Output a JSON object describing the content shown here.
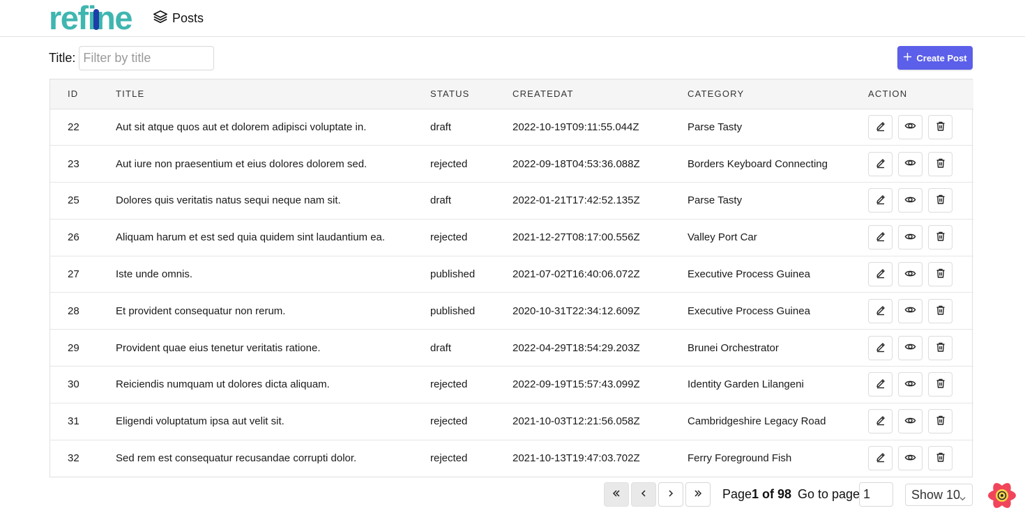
{
  "header": {
    "logo_text": "refine",
    "nav_label": "Posts"
  },
  "filter": {
    "label": "Title:",
    "placeholder": "Filter by title"
  },
  "create_button": {
    "label": "Create Post"
  },
  "table": {
    "columns": [
      "ID",
      "TITLE",
      "STATUS",
      "CREATEDAT",
      "CATEGORY",
      "ACTION"
    ],
    "rows": [
      {
        "id": "22",
        "title": "Aut sit atque quos aut et dolorem adipisci voluptate in.",
        "status": "draft",
        "created": "2022-10-19T09:11:55.044Z",
        "category": "Parse Tasty"
      },
      {
        "id": "23",
        "title": "Aut iure non praesentium et eius dolores dolorem sed.",
        "status": "rejected",
        "created": "2022-09-18T04:53:36.088Z",
        "category": "Borders Keyboard Connecting"
      },
      {
        "id": "25",
        "title": "Dolores quis veritatis natus sequi neque nam sit.",
        "status": "draft",
        "created": "2022-01-21T17:42:52.135Z",
        "category": "Parse Tasty"
      },
      {
        "id": "26",
        "title": "Aliquam harum et est sed quia quidem sint laudantium ea.",
        "status": "rejected",
        "created": "2021-12-27T08:17:00.556Z",
        "category": "Valley Port Car"
      },
      {
        "id": "27",
        "title": "Iste unde omnis.",
        "status": "published",
        "created": "2021-07-02T16:40:06.072Z",
        "category": "Executive Process Guinea"
      },
      {
        "id": "28",
        "title": "Et provident consequatur non rerum.",
        "status": "published",
        "created": "2020-10-31T22:34:12.609Z",
        "category": "Executive Process Guinea"
      },
      {
        "id": "29",
        "title": "Provident quae eius tenetur veritatis ratione.",
        "status": "draft",
        "created": "2022-04-29T18:54:29.203Z",
        "category": "Brunei Orchestrator"
      },
      {
        "id": "30",
        "title": "Reiciendis numquam ut dolores dicta aliquam.",
        "status": "rejected",
        "created": "2022-09-19T15:57:43.099Z",
        "category": "Identity Garden Lilangeni"
      },
      {
        "id": "31",
        "title": "Eligendi voluptatum ipsa aut velit sit.",
        "status": "rejected",
        "created": "2021-10-03T12:21:56.058Z",
        "category": "Cambridgeshire Legacy Road"
      },
      {
        "id": "32",
        "title": "Sed rem est consequatur recusandae corrupti dolor.",
        "status": "rejected",
        "created": "2021-10-13T19:47:03.702Z",
        "category": "Ferry Foreground Fish"
      }
    ]
  },
  "pagination": {
    "page_prefix": "Page",
    "page_current": "1 of 98",
    "goto_label": "Go to page:",
    "goto_value": "1",
    "show_label": "Show 10"
  },
  "colors": {
    "accent": "#5b5fe9",
    "logo_teal": "#3fb6b0",
    "logo_blue": "#1d3da8"
  },
  "icons": [
    "layers-icon",
    "plus-icon",
    "edit-icon",
    "eye-icon",
    "trash-icon",
    "chevrons-left-icon",
    "chevron-left-icon",
    "chevron-right-icon",
    "chevrons-right-icon",
    "chevron-down-icon",
    "devtools-logo-icon"
  ]
}
